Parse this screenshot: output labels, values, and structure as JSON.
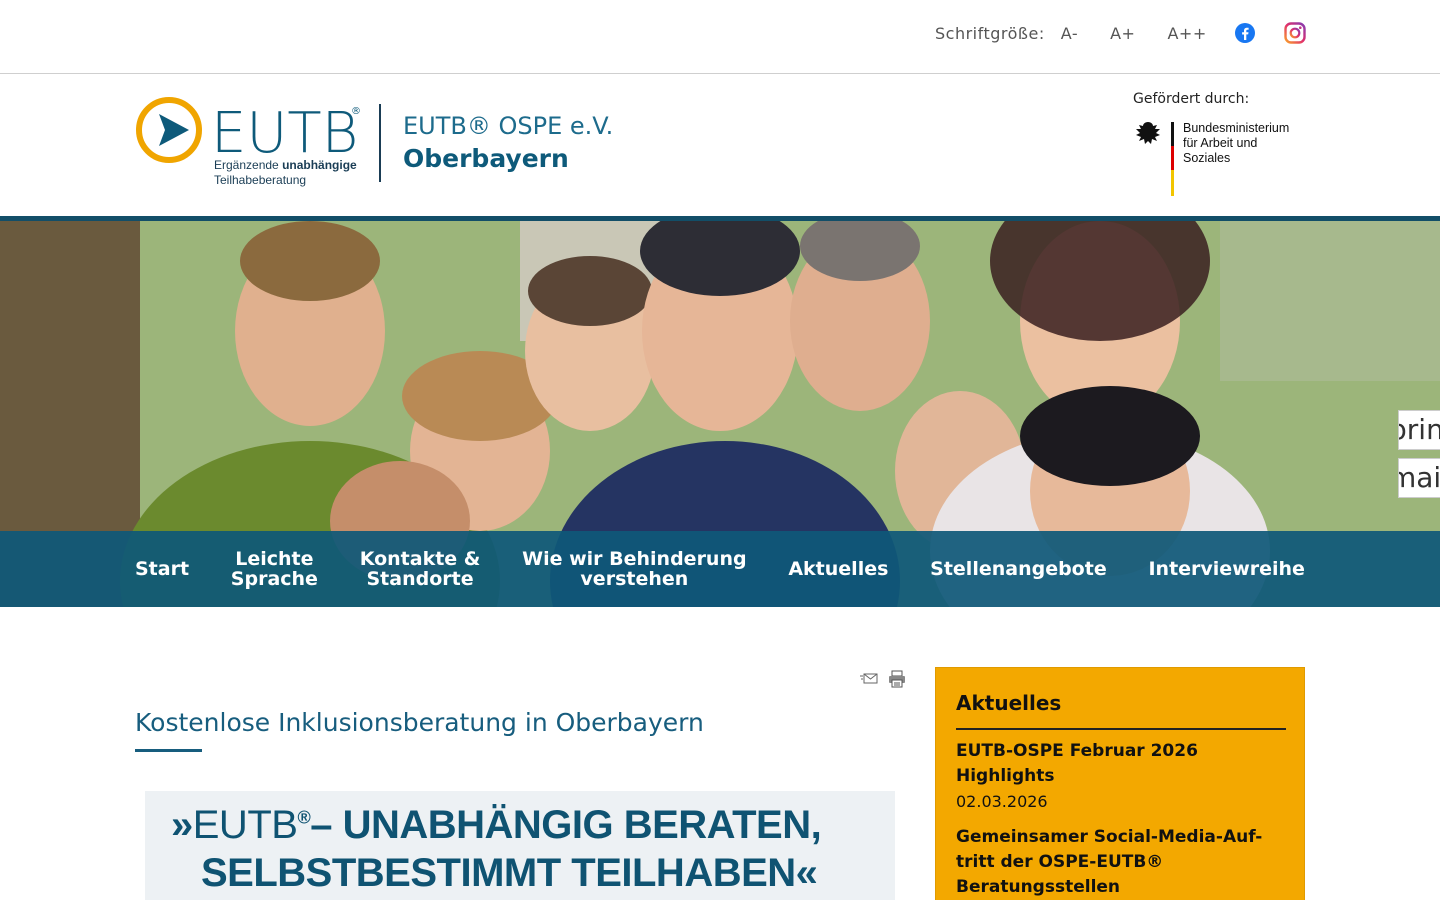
{
  "topbar": {
    "font_size_label": "Schriftgröße:",
    "font_size_options": [
      "A-",
      "A+",
      "A++"
    ],
    "social": [
      "facebook-icon",
      "instagram-icon"
    ]
  },
  "header": {
    "logo": {
      "wordmark": "EUTB",
      "registered": "®",
      "subtitle_line1_normal": "Ergänzende ",
      "subtitle_line1_bold": "unabhängige",
      "subtitle_line2": "Teilhabeberatung"
    },
    "brand_line1": "EUTB® OSPE e.V.",
    "brand_line2": "Oberbayern",
    "funded_by_label": "Gefördert durch:",
    "ministry_line1": "Bundesministerium",
    "ministry_line2": "für Arbeit und Soziales"
  },
  "side_tabs": [
    "prin",
    "mai"
  ],
  "nav": {
    "items": [
      {
        "line1": "Start",
        "line2": ""
      },
      {
        "line1": "Leichte",
        "line2": "Sprache"
      },
      {
        "line1": "Kontakte &",
        "line2": "Standorte"
      },
      {
        "line1": "Wie wir Behinderung",
        "line2": "verstehen"
      },
      {
        "line1": "Aktuelles",
        "line2": ""
      },
      {
        "line1": "Stellenangebote",
        "line2": ""
      },
      {
        "line1": "Interviewreihe",
        "line2": ""
      }
    ]
  },
  "main": {
    "page_title": "Kostenlose Inklusionsberatung in Oberbayern",
    "banner": {
      "quote_open": "»",
      "eutb": "EUTB",
      "reg": "®",
      "line1_rest": "– UNABHÄNGIG BERATEN,",
      "line2": "SELBSTBESTIMMT TEILHABEN«"
    }
  },
  "sidebar": {
    "title": "Aktuelles",
    "news": [
      {
        "title": "EUTB-OSPE Februar 2026 Highlights",
        "date": "02.03.2026"
      },
      {
        "title": "Gemeinsamer Social-Media-Auf-tritt der OSPE-EUTB® Beratungsstellen",
        "date": ""
      }
    ]
  },
  "colors": {
    "primary": "#0e5a7a",
    "nav_bg": "#0e5878",
    "sidebar_bg": "#f3a800",
    "logo_orange": "#f0a500"
  }
}
